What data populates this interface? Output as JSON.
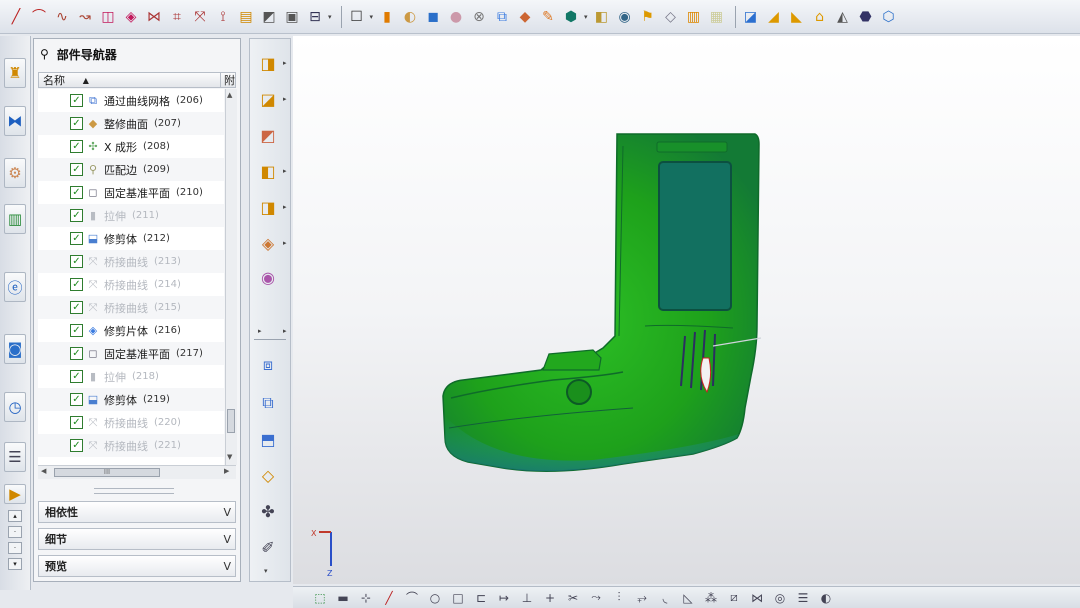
{
  "colors": {
    "model_green": "#1fa31c",
    "model_teal": "#127060",
    "check_green": "#1e8a1e"
  },
  "navigator": {
    "title": "部件导航器",
    "col_name": "名称",
    "col_update": "附",
    "features": [
      {
        "name": "通过曲线网格",
        "id": "(206)",
        "active": true,
        "icon": "mesh-surface-icon"
      },
      {
        "name": "整修曲面",
        "id": "(207)",
        "active": true,
        "icon": "trim-surface-icon"
      },
      {
        "name": "X 成形",
        "id": "(208)",
        "active": true,
        "icon": "x-form-icon"
      },
      {
        "name": "匹配边",
        "id": "(209)",
        "active": true,
        "icon": "match-edge-icon"
      },
      {
        "name": "固定基准平面",
        "id": "(210)",
        "active": true,
        "icon": "datum-plane-icon"
      },
      {
        "name": "拉伸",
        "id": "(211)",
        "active": false,
        "icon": "extrude-icon"
      },
      {
        "name": "修剪体",
        "id": "(212)",
        "active": true,
        "icon": "trim-body-icon"
      },
      {
        "name": "桥接曲线",
        "id": "(213)",
        "active": false,
        "icon": "bridge-curve-icon"
      },
      {
        "name": "桥接曲线",
        "id": "(214)",
        "active": false,
        "icon": "bridge-curve-icon"
      },
      {
        "name": "桥接曲线",
        "id": "(215)",
        "active": false,
        "icon": "bridge-curve-icon"
      },
      {
        "name": "修剪片体",
        "id": "(216)",
        "active": true,
        "icon": "trim-sheet-icon"
      },
      {
        "name": "固定基准平面",
        "id": "(217)",
        "active": true,
        "icon": "datum-plane-icon"
      },
      {
        "name": "拉伸",
        "id": "(218)",
        "active": false,
        "icon": "extrude-icon"
      },
      {
        "name": "修剪体",
        "id": "(219)",
        "active": true,
        "icon": "trim-body-icon"
      },
      {
        "name": "桥接曲线",
        "id": "(220)",
        "active": false,
        "icon": "bridge-curve-icon"
      },
      {
        "name": "桥接曲线",
        "id": "(221)",
        "active": false,
        "icon": "bridge-curve-icon"
      }
    ],
    "panels": [
      {
        "label": "相依性"
      },
      {
        "label": "细节"
      },
      {
        "label": "预览"
      }
    ],
    "hscroll_label": "III"
  },
  "viewport": {
    "axis_x": "X",
    "axis_z": "Z"
  }
}
